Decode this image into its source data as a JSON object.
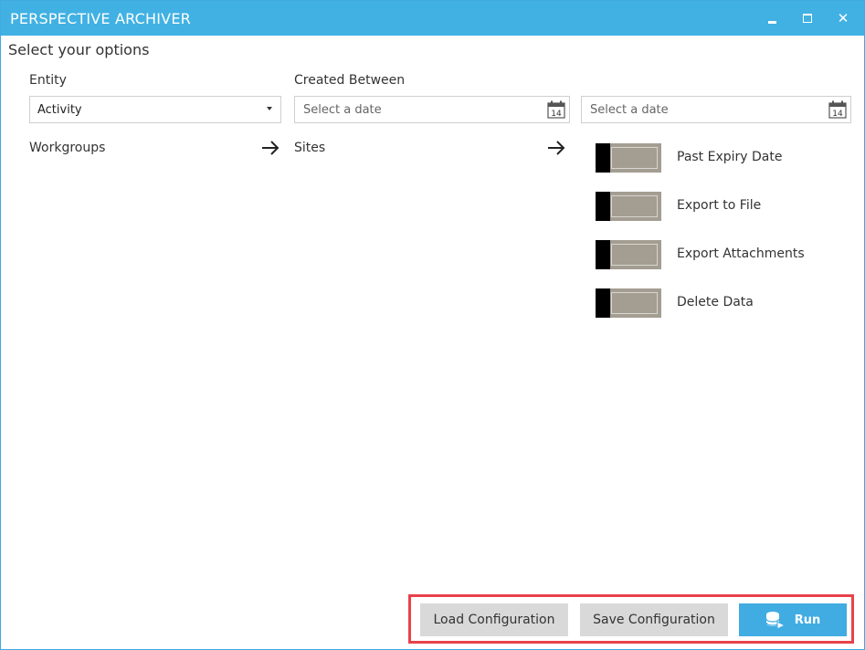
{
  "window": {
    "title": "PERSPECTIVE ARCHIVER",
    "controls": [
      "minimize-icon",
      "maximize-icon",
      "close-icon"
    ],
    "close_glyph": "✕",
    "titlebar_color": "#41b1e3"
  },
  "options": {
    "heading": "Select your options",
    "entity": {
      "label": "Entity",
      "selected": "Activity"
    },
    "created_between": {
      "label": "Created Between",
      "from_placeholder": "Select a date",
      "to_placeholder": "Select a date",
      "calendar_day": "14"
    },
    "workgroups": {
      "label": "Workgroups"
    },
    "sites": {
      "label": "Sites"
    },
    "toggles": [
      {
        "label": "Past Expiry Date",
        "on": false
      },
      {
        "label": "Export to File",
        "on": false
      },
      {
        "label": "Export Attachments",
        "on": false
      },
      {
        "label": "Delete Data",
        "on": false
      }
    ]
  },
  "footer": {
    "load_label": "Load Configuration",
    "save_label": "Save Configuration",
    "run_label": "Run",
    "highlight_color": "#e8424a",
    "run_color": "#40ace2"
  }
}
